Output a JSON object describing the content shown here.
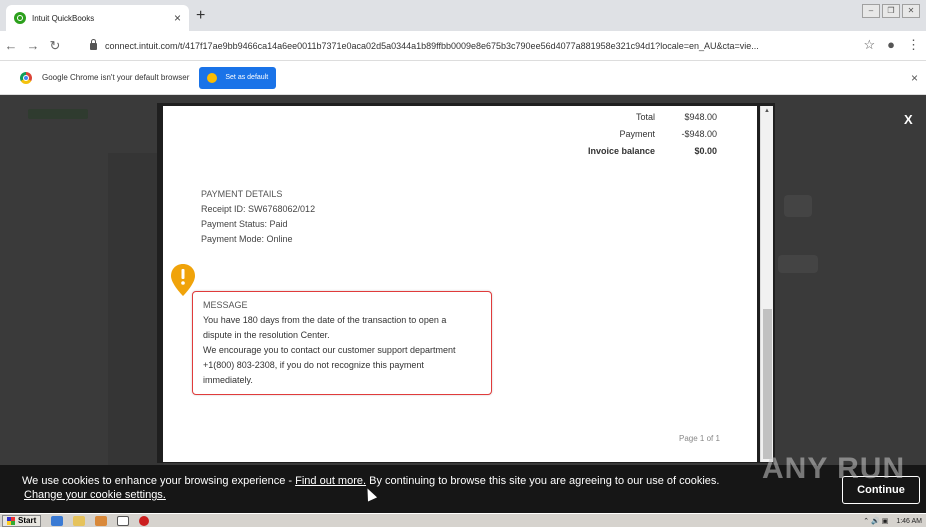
{
  "browser": {
    "tab_title": "Intuit QuickBooks",
    "tab_close": "×",
    "new_tab": "+",
    "url": "connect.intuit.com/t/417f17ae9bb9466ca14a6ee0011b7371e0aca02d5a0344a1b89ffbb0009e8e675b3c790ee56d4077a881958e321c94d1?locale=en_AU&cta=vie...",
    "infobar_text": "Google Chrome isn't your default browser",
    "set_default_label": "Set as default",
    "infobar_close": "×"
  },
  "overlay": {
    "close_label": "X"
  },
  "invoice": {
    "total_label": "Total",
    "total_value": "$948.00",
    "payment_label": "Payment",
    "payment_value": "-$948.00",
    "balance_label": "Invoice balance",
    "balance_value": "$0.00"
  },
  "payment_details": {
    "heading": "PAYMENT DETAILS",
    "receipt": "Receipt ID: SW6768062/012",
    "status": "Payment Status: Paid",
    "mode": "Payment Mode: Online"
  },
  "message": {
    "heading": "MESSAGE",
    "line1": "You have 180 days from the date of the transaction to open a",
    "line2": "dispute in the resolution Center.",
    "line3": "We encourage you to contact our customer support department",
    "line4": "+1(800) 803-2308, if you do not recognize this payment",
    "line5": "immediately."
  },
  "page_number": "Page 1 of 1",
  "cookie": {
    "text_before": "We use cookies to enhance your browsing experience - ",
    "find_out_more": "Find out more.",
    "text_after": " By continuing to browse this site you are agreeing to our use of cookies.",
    "change_settings": "Change your cookie settings.",
    "continue_label": "Continue"
  },
  "watermark": "ANY RUN",
  "taskbar": {
    "start_label": "Start",
    "clock": "1:46 AM"
  },
  "colors": {
    "accent_blue": "#1a73e8",
    "message_border": "#e03b3b",
    "alert_orange": "#f0a30a",
    "quickbooks_green": "#2ca01c"
  }
}
